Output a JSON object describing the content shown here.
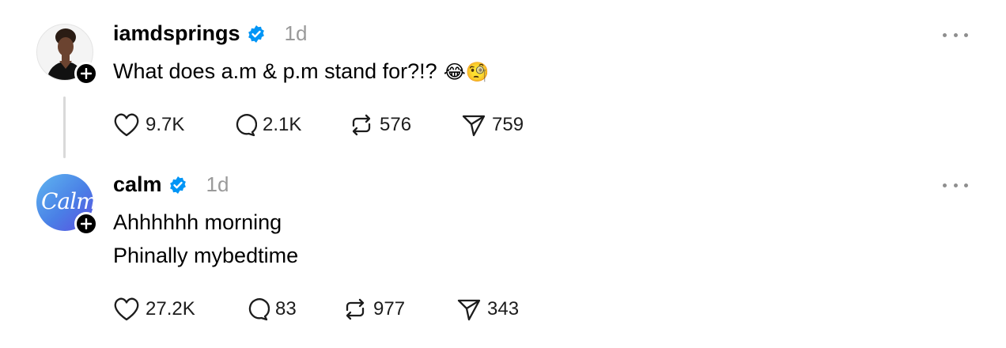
{
  "posts": [
    {
      "username": "iamdsprings",
      "time": "1d",
      "text_lines": [
        "What does a.m & p.m stand for?!?"
      ],
      "emojis": "😂🧐",
      "avatar": "person-photo",
      "actions": {
        "likes": "9.7K",
        "replies": "2.1K",
        "reposts": "576",
        "shares": "759"
      }
    },
    {
      "username": "calm",
      "time": "1d",
      "avatar_text": "Calm",
      "text_lines": [
        "Ahhhhhh morning",
        "Phinally mybedtime"
      ],
      "actions": {
        "likes": "27.2K",
        "replies": "83",
        "reposts": "977",
        "shares": "343"
      }
    }
  ],
  "colors": {
    "verified": "#0095f6",
    "muted": "#9a9a9a",
    "thread_line": "#d9d9d9",
    "calm_gradient": [
      "#5fb6f0",
      "#5b4fe0"
    ]
  },
  "icons": [
    "heart-icon",
    "comment-icon",
    "repost-icon",
    "share-icon",
    "verified-icon",
    "more-icon",
    "plus-icon"
  ]
}
